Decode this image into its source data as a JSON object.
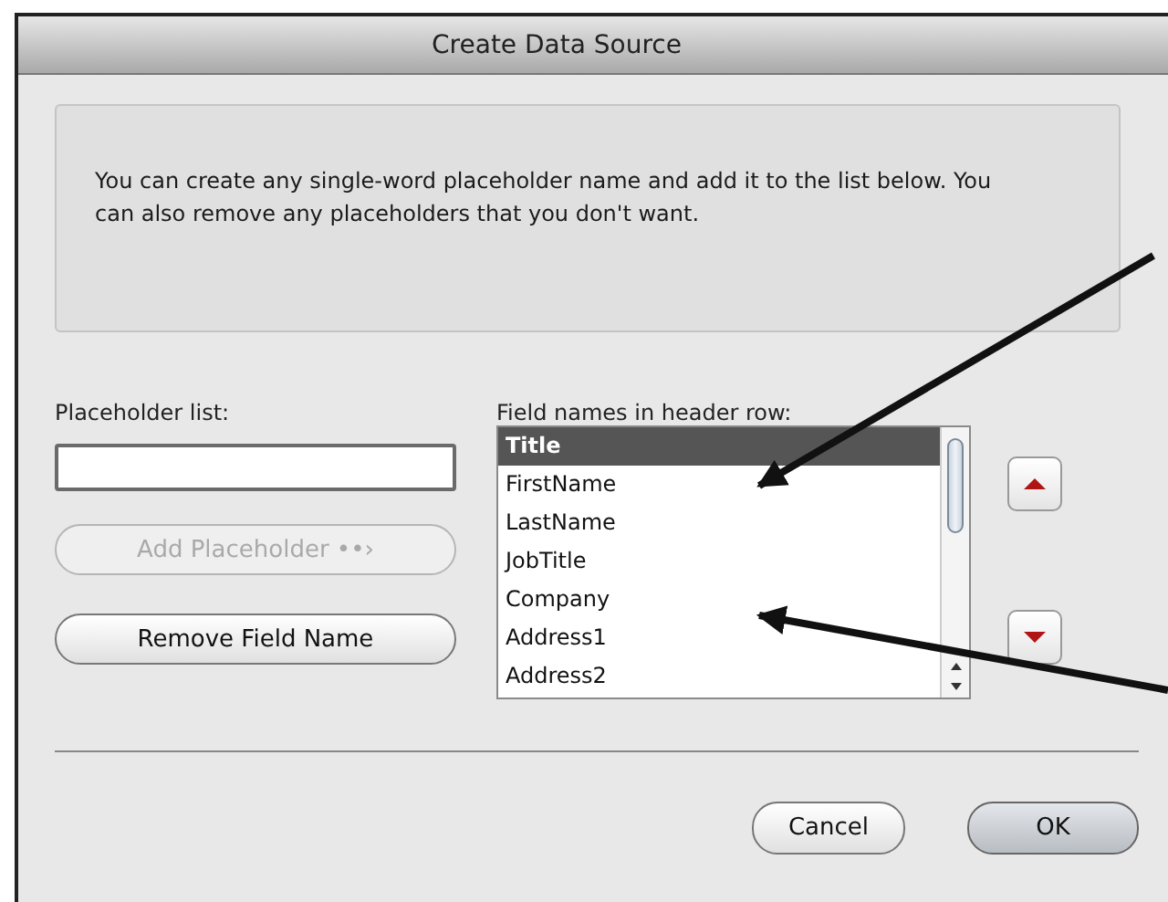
{
  "window": {
    "title": "Create Data Source"
  },
  "description": "You can create any single-word placeholder name and add it to the list below.  You can also remove any placeholders that you don't want.",
  "placeholder_list": {
    "label": "Placeholder list:"
  },
  "side_buttons": [
    {
      "label": "Add Placeholder ••›",
      "disabled": true
    },
    {
      "label": "Remove Field Name",
      "disabled": false
    }
  ],
  "field_names": {
    "label": "Field names in header row:",
    "items": [
      {
        "label": "Title",
        "selected": true
      },
      {
        "label": "FirstName",
        "selected": false
      },
      {
        "label": "LastName",
        "selected": false
      },
      {
        "label": "JobTitle",
        "selected": false
      },
      {
        "label": "Company",
        "selected": false
      },
      {
        "label": "Address1",
        "selected": false
      },
      {
        "label": "Address2",
        "selected": false
      }
    ]
  },
  "footer_buttons": [
    {
      "label": "Cancel",
      "default": false
    },
    {
      "label": "OK",
      "default": true
    }
  ]
}
